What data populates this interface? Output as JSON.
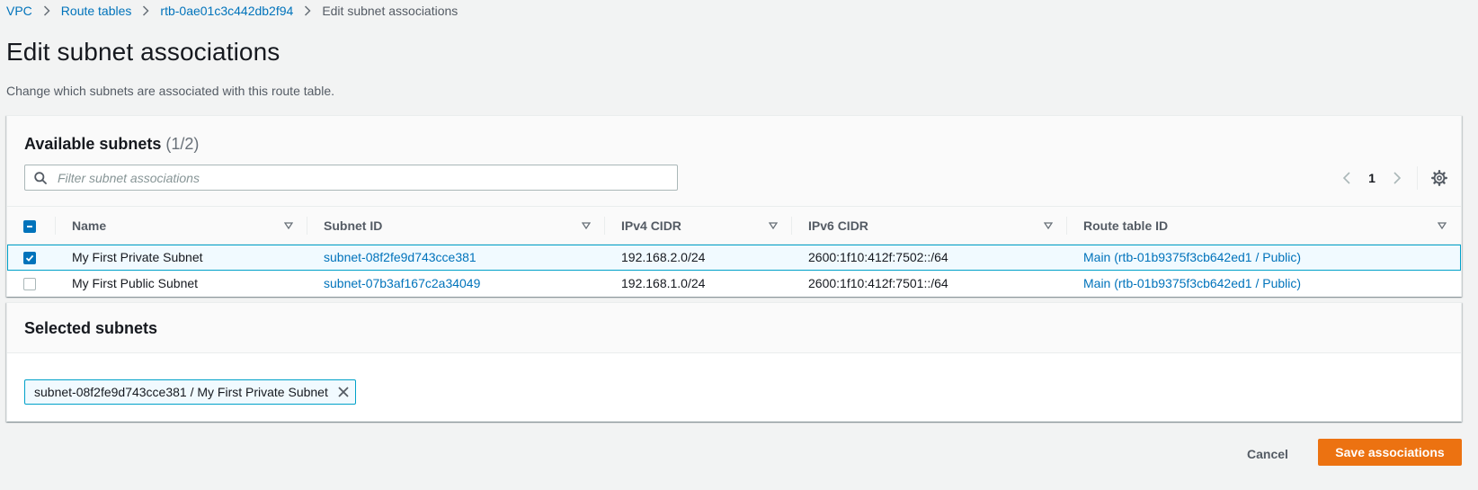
{
  "breadcrumb": {
    "items": [
      "VPC",
      "Route tables",
      "rtb-0ae01c3c442db2f94"
    ],
    "current": "Edit subnet associations"
  },
  "page": {
    "title": "Edit subnet associations",
    "description": "Change which subnets are associated with this route table."
  },
  "available": {
    "title": "Available subnets",
    "count": "(1/2)",
    "filter_placeholder": "Filter subnet associations",
    "page_number": "1",
    "columns": [
      "Name",
      "Subnet ID",
      "IPv4 CIDR",
      "IPv6 CIDR",
      "Route table ID"
    ],
    "rows": [
      {
        "checked": true,
        "name": "My First Private Subnet",
        "subnet_id": "subnet-08f2fe9d743cce381",
        "ipv4": "192.168.2.0/24",
        "ipv6": "2600:1f10:412f:7502::/64",
        "route_table": "Main (rtb-01b9375f3cb642ed1 / Public)"
      },
      {
        "checked": false,
        "name": "My First Public Subnet",
        "subnet_id": "subnet-07b3af167c2a34049",
        "ipv4": "192.168.1.0/24",
        "ipv6": "2600:1f10:412f:7501::/64",
        "route_table": "Main (rtb-01b9375f3cb642ed1 / Public)"
      }
    ]
  },
  "selected": {
    "title": "Selected subnets",
    "tokens": [
      "subnet-08f2fe9d743cce381 / My First Private Subnet"
    ]
  },
  "actions": {
    "cancel": "Cancel",
    "save": "Save associations"
  },
  "colors": {
    "link": "#0073bb",
    "primary": "#ec7211",
    "selection": "#00a1c9"
  }
}
